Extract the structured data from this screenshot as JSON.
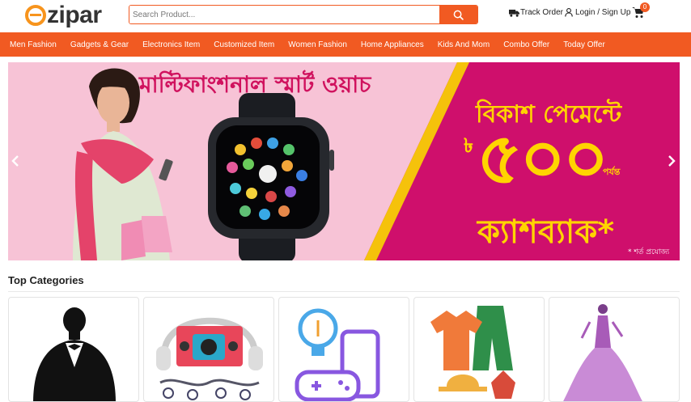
{
  "header": {
    "logo_text": "ezipar",
    "search_placeholder": "Search Product...",
    "track_order": "Track Order",
    "login": "Login / Sign Up",
    "cart_count": "0"
  },
  "nav": {
    "items": [
      "Men Fashion",
      "Gadgets & Gear",
      "Electronics Item",
      "Customized Item",
      "Women Fashion",
      "Home Appliances",
      "Kids And Mom",
      "Combo Offer",
      "Today Offer"
    ]
  },
  "banner": {
    "title": "মাল্টিফাংশনাল স্মার্ট ওয়াচ",
    "payment": "বিকাশ পেমেন্টে",
    "taka_symbol": "৳",
    "amount": "৫০০",
    "upto": "পর্যন্ত",
    "cashback": "ক্যাশব্যাক*",
    "terms": "* শর্ত প্রযোজ্য",
    "colors": {
      "left_bg": "#f7c3d6",
      "right_bg": "#cf0f6c",
      "accent": "#ffd400"
    }
  },
  "categories": {
    "title": "Top Categories"
  },
  "colors": {
    "brand": "#f15a22",
    "logo_accent": "#f7941d"
  }
}
